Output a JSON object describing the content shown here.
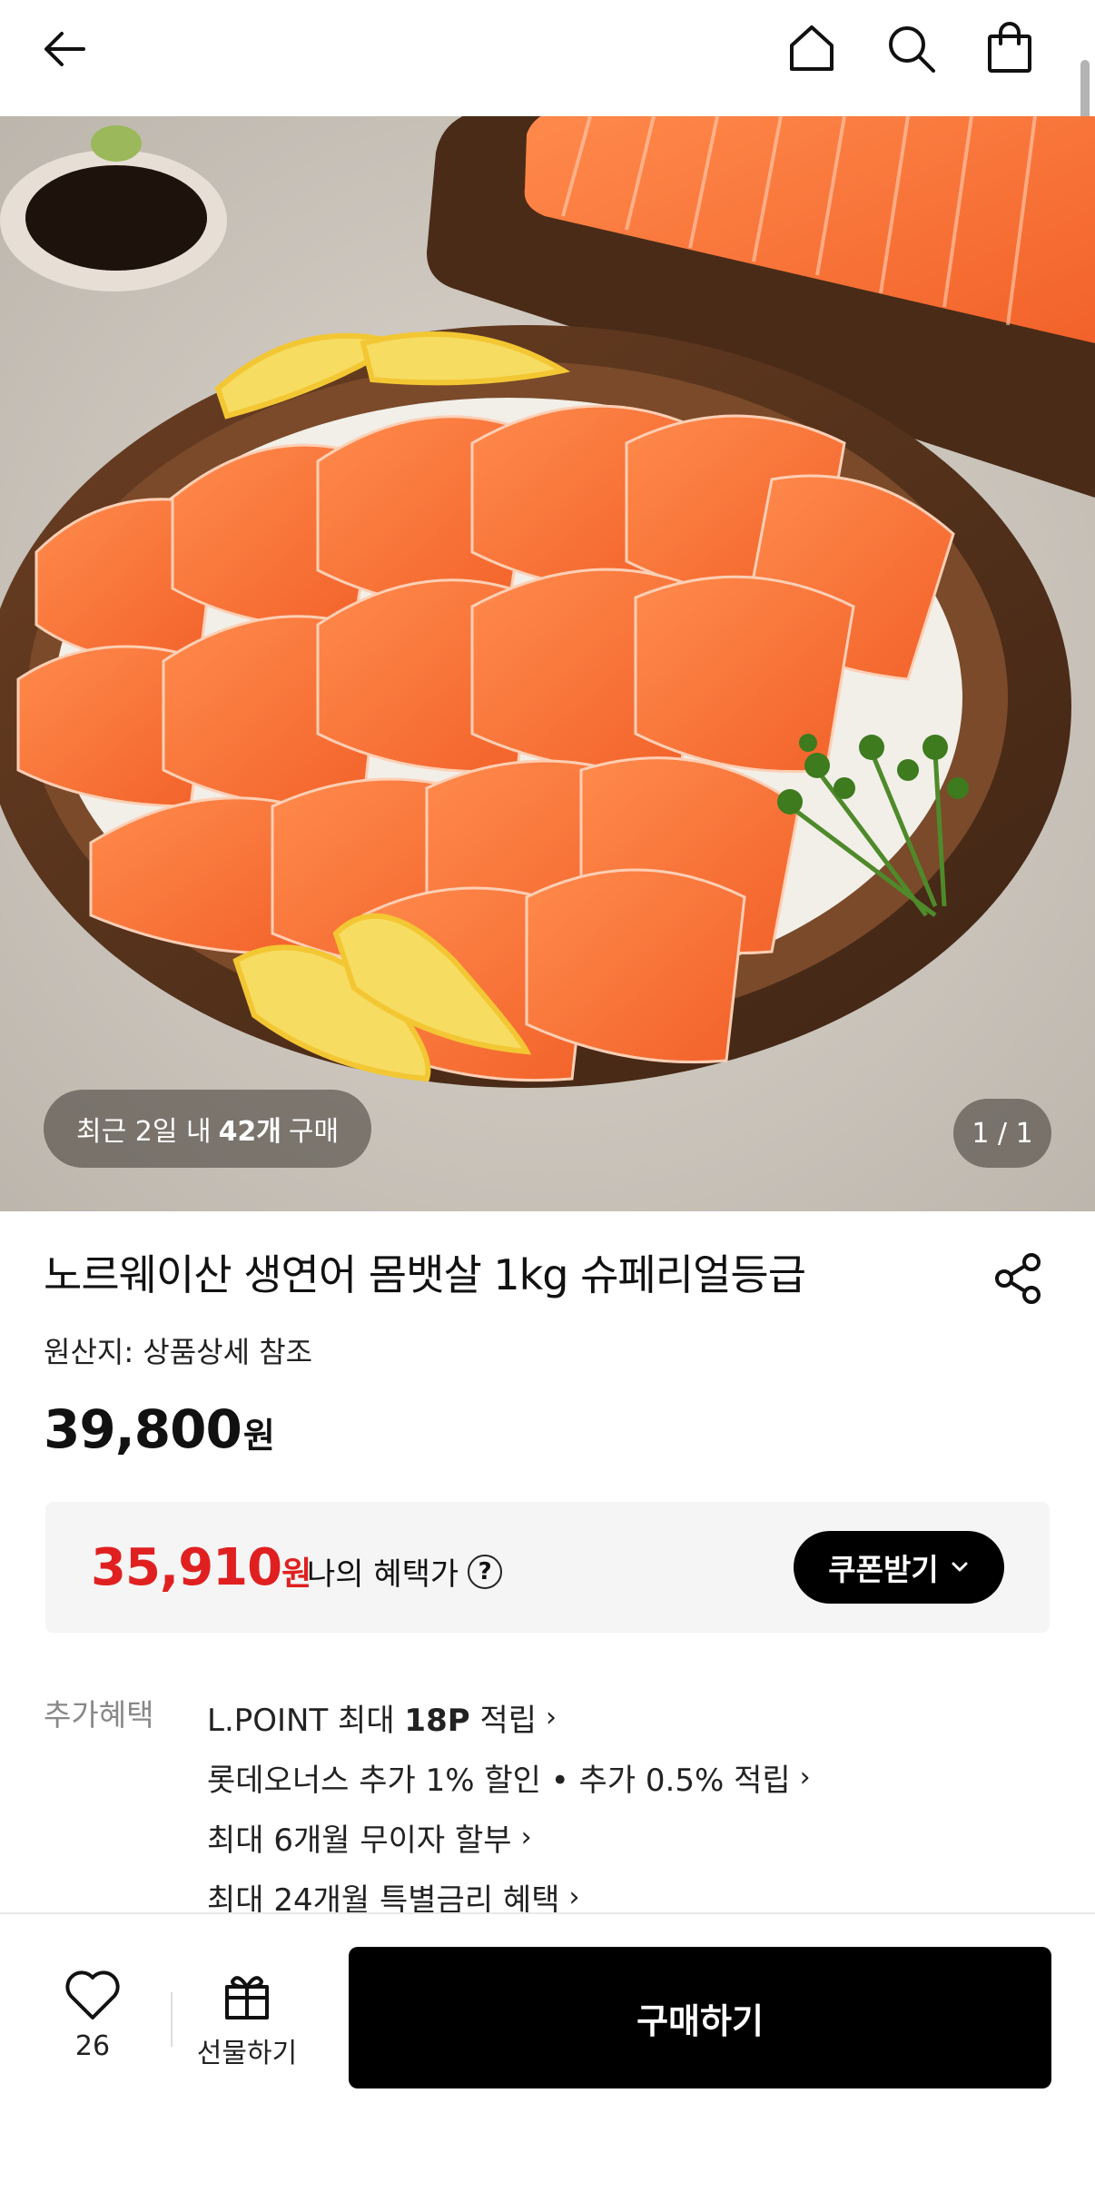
{
  "header": {
    "back_icon": "arrow-left-icon",
    "home_icon": "home-icon",
    "search_icon": "search-icon",
    "cart_icon": "shopping-bag-icon"
  },
  "hero": {
    "recent_prefix": "최근 2일 내",
    "recent_count": "42개",
    "recent_suffix": "구매",
    "page_indicator": "1 / 1"
  },
  "product": {
    "title": "노르웨이산 생연어 몸뱃살 1kg 슈페리얼등급",
    "origin": "원산지: 상품상세 참조",
    "price": "39,800",
    "price_unit": "원"
  },
  "benefit": {
    "price": "35,910",
    "price_unit": "원",
    "label": "나의 혜택가",
    "help": "?",
    "coupon_button": "쿠폰받기"
  },
  "extra": {
    "label": "추가혜택",
    "items": [
      {
        "pre": "L.POINT 최대 ",
        "bold": "18P",
        "post": " 적립"
      },
      {
        "pre": "롯데오너스 추가 1% 할인 • 추가 0.5% 적립",
        "bold": "",
        "post": ""
      },
      {
        "pre": "최대 6개월 무이자 할부",
        "bold": "",
        "post": ""
      },
      {
        "pre": "최대 24개월 특별금리 혜택",
        "bold": "",
        "post": ""
      }
    ]
  },
  "bottom": {
    "like_count": "26",
    "gift_label": "선물하기",
    "buy_label": "구매하기"
  },
  "colors": {
    "accent_red": "#e02020",
    "button_black": "#000000"
  }
}
